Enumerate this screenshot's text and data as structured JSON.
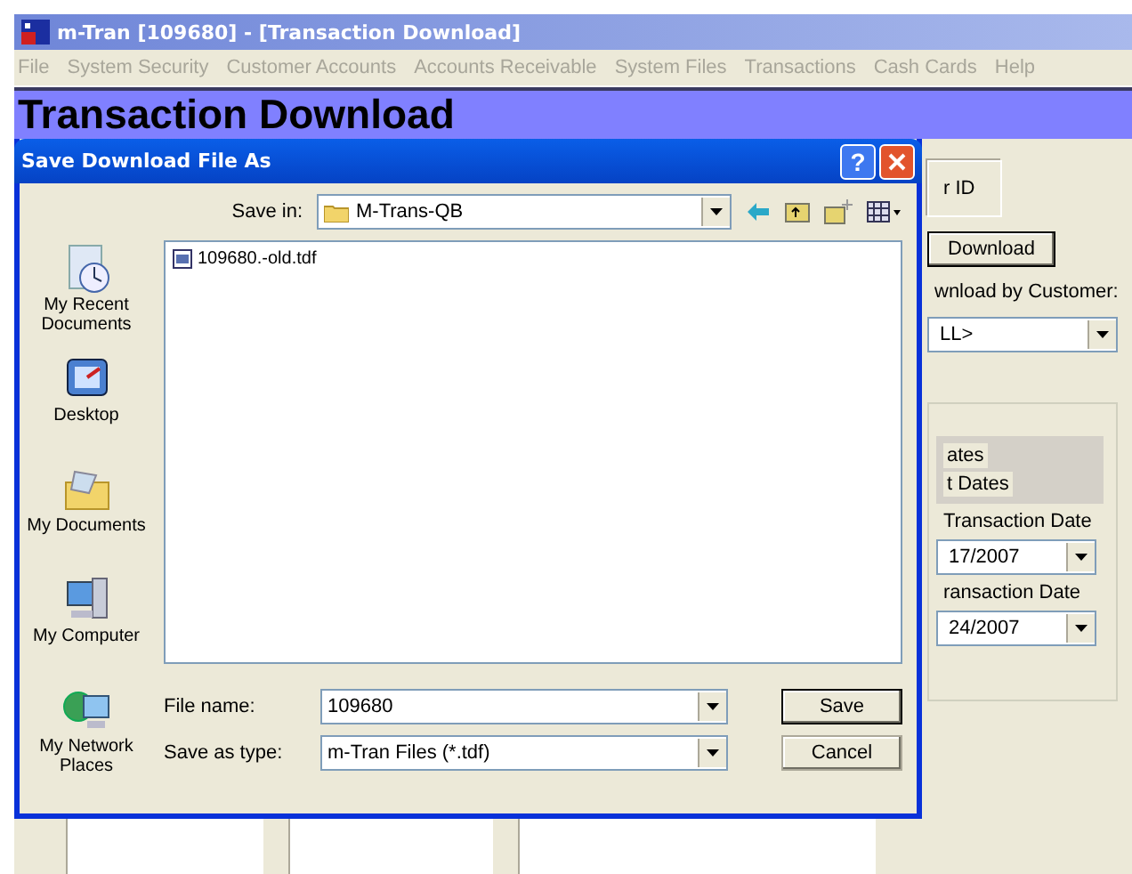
{
  "window": {
    "title": "m-Tran [109680] - [Transaction Download]"
  },
  "menu": [
    "File",
    "System Security",
    "Customer Accounts",
    "Accounts Receivable",
    "System Files",
    "Transactions",
    "Cash Cards",
    "Help"
  ],
  "page_title": "Transaction Download",
  "background_form": {
    "id_label": "r ID",
    "download_button": "Download",
    "customer_label": "wnload by Customer:",
    "customer_value": "LL>",
    "date_options": [
      "ates",
      "t Dates"
    ],
    "start_date_label": "Transaction Date",
    "start_date": "17/2007",
    "end_date_label": "ransaction Date",
    "end_date": "24/2007"
  },
  "dialog": {
    "title": "Save Download File As",
    "help_button": "?",
    "save_in_label": "Save in:",
    "save_in_value": "M-Trans-QB",
    "places": [
      {
        "label": "My Recent Documents",
        "kind": "recent"
      },
      {
        "label": "Desktop",
        "kind": "desktop"
      },
      {
        "label": "My Documents",
        "kind": "documents"
      },
      {
        "label": "My Computer",
        "kind": "computer"
      },
      {
        "label": "My Network Places",
        "kind": "network"
      }
    ],
    "files": [
      "109680.-old.tdf"
    ],
    "file_name_label": "File name:",
    "file_name": "109680",
    "save_type_label": "Save as type:",
    "save_type": "m-Tran Files (*.tdf)",
    "buttons": [
      "Save",
      "Cancel"
    ]
  }
}
